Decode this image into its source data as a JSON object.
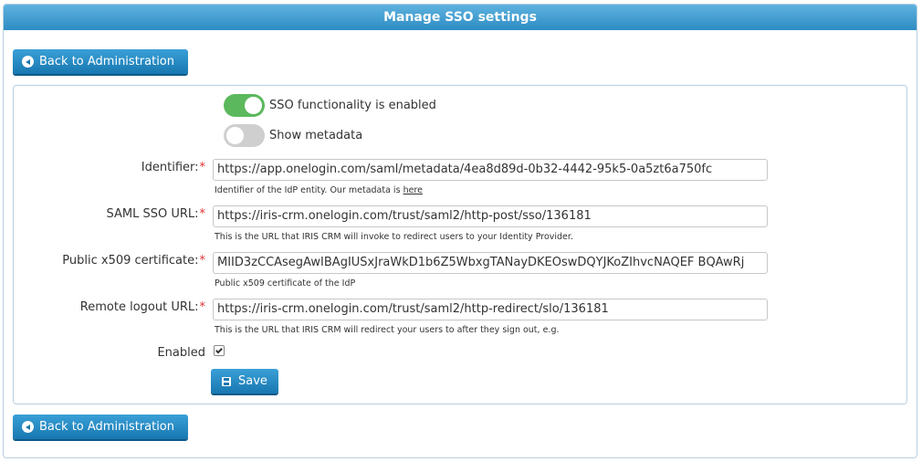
{
  "header": {
    "title": "Manage SSO settings"
  },
  "nav": {
    "back_label": "Back to Administration"
  },
  "toggles": {
    "sso_enabled": {
      "label": "SSO functionality is enabled",
      "state": "on"
    },
    "show_metadata": {
      "label": "Show metadata",
      "state": "off"
    }
  },
  "fields": {
    "identifier": {
      "label": "Identifier:",
      "value": "https://app.onelogin.com/saml/metadata/4ea8d89d-0b32-4442-95k5-0a5zt6a750fc",
      "hint": "Identifier of the IdP entity. Our metadata is",
      "hint_link": "here"
    },
    "sso_url": {
      "label": "SAML SSO URL:",
      "value": "https://iris-crm.onelogin.com/trust/saml2/http-post/sso/136181",
      "hint": "This is the URL that IRIS CRM will invoke to redirect users to your Identity Provider."
    },
    "certificate": {
      "label": "Public x509 certificate:",
      "value": "MIID3zCCAsegAwIBAgIUSxJraWkD1b6Z5WbxgTANayDKEOswDQYJKoZIhvcNAQEF BQAwRj",
      "hint": "Public x509 certificate of the IdP"
    },
    "logout_url": {
      "label": "Remote logout URL:",
      "value": "https://iris-crm.onelogin.com/trust/saml2/http-redirect/slo/136181",
      "hint": "This is the URL that IRIS CRM will redirect your users to after they sign out, e.g."
    }
  },
  "required_mark": "*",
  "enabled": {
    "label": "Enabled",
    "checked": true
  },
  "actions": {
    "save_label": "Save"
  }
}
